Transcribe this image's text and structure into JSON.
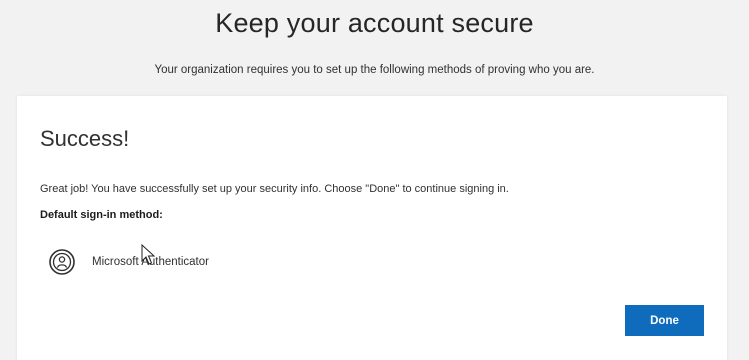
{
  "header": {
    "title": "Keep your account secure",
    "subtitle": "Your organization requires you to set up the following methods of proving who you are."
  },
  "card": {
    "heading": "Success!",
    "message": "Great job! You have successfully set up your security info. Choose \"Done\" to continue signing in.",
    "default_method_label": "Default sign-in method:",
    "method": {
      "name": "Microsoft Authenticator",
      "icon": "authenticator-icon"
    },
    "done_label": "Done"
  },
  "colors": {
    "accent": "#0f6cbd",
    "background": "#f2f2f2",
    "card": "#ffffff"
  }
}
